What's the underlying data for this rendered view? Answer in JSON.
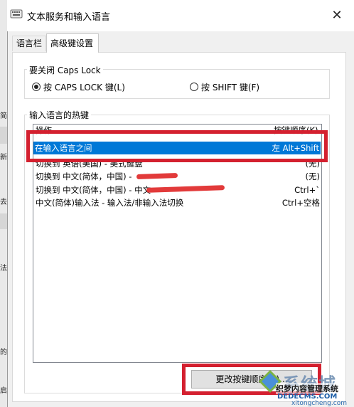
{
  "background_window": {
    "chars": [
      "简",
      "新",
      "去",
      "法",
      "的",
      "启"
    ]
  },
  "dialog": {
    "title": "文本服务和输入语言",
    "close_icon": "close-icon",
    "tabs": [
      {
        "label": "语言栏"
      },
      {
        "label": "高级键设置"
      }
    ],
    "caps_lock": {
      "legend": "要关闭 Caps Lock",
      "options": [
        {
          "label": "按 CAPS LOCK 键(L)",
          "selected": true
        },
        {
          "label": "按 SHIFT 键(F)",
          "selected": false
        }
      ]
    },
    "hotkeys": {
      "legend": "输入语言的热键",
      "columns": [
        "操作",
        "按键顺序(K)"
      ],
      "rows": [
        {
          "action": "在输入语言之间",
          "keys": "左 Alt+Shift",
          "selected": true
        },
        {
          "action": "切换到 英语(美国) - 美式键盘",
          "keys": "(无)"
        },
        {
          "action": "切换到 中文(简体，中国) -",
          "keys": "(无)"
        },
        {
          "action": "切换到 中文(简体，中国) - 中文",
          "keys": "Ctrl+`"
        },
        {
          "action": "中文(简体)输入法 - 输入法/非输入法切换",
          "keys": "Ctrl+空格"
        }
      ],
      "change_button": "更改按键顺序(C)..."
    }
  },
  "watermark": {
    "brand": "系统城",
    "line1": "织梦内容管理系统",
    "line2": "DEDECMS.COM",
    "line3": "xitongcheng.com"
  },
  "colors": {
    "selection": "#0078d7",
    "highlight_box": "#d4202f"
  }
}
